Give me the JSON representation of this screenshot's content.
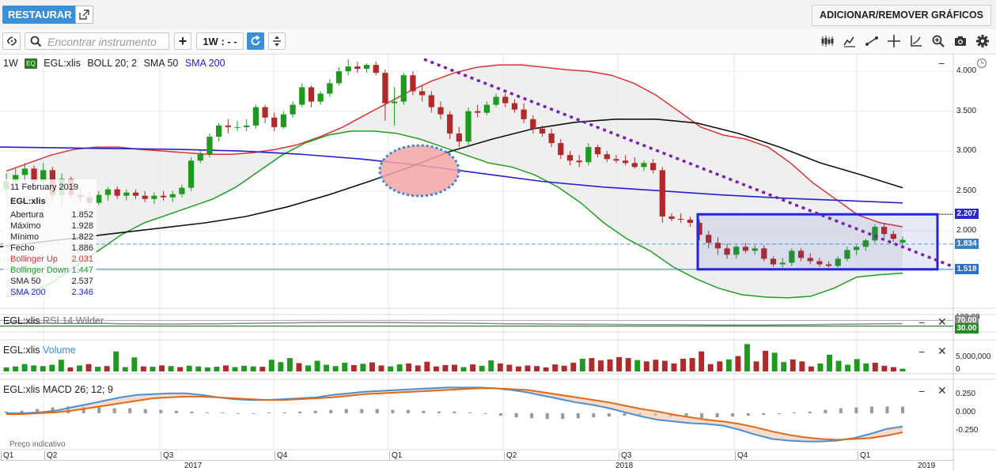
{
  "top_bar": {
    "restore_label": "RESTAURAR",
    "add_remove_label": "ADICIONAR/REMOVER GRÁFICOS"
  },
  "toolbar": {
    "search_placeholder": "Encontrar instrumento",
    "add_label": "+",
    "timeframe_label": "1W : - -"
  },
  "main_chart": {
    "timeframe": "1W",
    "eq_badge": "EQ",
    "symbol": "EGL:xlis",
    "boll": "BOLL 20; 2",
    "sma50": "SMA 50",
    "sma200": "SMA 200",
    "y_ticks": [
      "4.000",
      "3.500",
      "3.000",
      "2.500",
      "2.000",
      "1.500"
    ],
    "price_tags": [
      {
        "value": "2.207",
        "color": "#2a2ad0"
      },
      {
        "value": "1.834",
        "color": "#3a80c8"
      },
      {
        "value": "1.518",
        "color": "#2a6ed0"
      }
    ]
  },
  "info_box": {
    "date": "11 February 2019",
    "symbol": "EGL:xlis",
    "rows": [
      {
        "label": "Abertura",
        "value": "1.852",
        "color": "#222222"
      },
      {
        "label": "Máximo",
        "value": "1.928",
        "color": "#222222"
      },
      {
        "label": "Mínimo",
        "value": "1.822",
        "color": "#222222"
      },
      {
        "label": "Fecho",
        "value": "1.886",
        "color": "#222222"
      },
      {
        "label": "Bollinger Up",
        "value": "2.031",
        "color": "#d33333"
      },
      {
        "label": "Bollinger Down",
        "value": "1.447",
        "color": "#1e9a1e"
      },
      {
        "label": "SMA 50",
        "value": "2.537",
        "color": "#222222"
      },
      {
        "label": "SMA 200",
        "value": "2.346",
        "color": "#2222cc"
      }
    ]
  },
  "rsi_panel": {
    "symbol": "EGL:xlis",
    "label": "RSI 14 Wilder",
    "tick_top": "100.00",
    "tick_70": "70.00",
    "tick_30": "30.00"
  },
  "volume_panel": {
    "symbol": "EGL:xlis",
    "label": "Volume",
    "tick_top": "5,000,000",
    "tick_zero": "0"
  },
  "macd_panel": {
    "symbol": "EGL:xlis",
    "label": "MACD 26; 12; 9",
    "ticks": [
      "0.250",
      "0.000",
      "-0.250"
    ]
  },
  "footer": {
    "note": "Preço indicativo",
    "quarters": [
      "Q1",
      "Q2",
      "Q3",
      "Q4",
      "Q1",
      "Q2",
      "Q3",
      "Q4",
      "Q1"
    ],
    "years": [
      "2017",
      "2018",
      "2019"
    ]
  },
  "colors": {
    "accent": "#3a8fd8",
    "bull": "#1e9a1e",
    "bear": "#b02a2a",
    "boll_up": "#dd3333",
    "boll_down": "#1ea01e",
    "sma50": "#111111",
    "sma200": "#2222cc",
    "trend": "#7b1fb0",
    "rect": "#2424d8"
  },
  "chart_data": [
    {
      "type": "candlestick",
      "title": "EGL:xlis",
      "ylim": [
        1.05,
        4.2
      ],
      "y_ticks": [
        1.5,
        2.0,
        2.5,
        3.0,
        3.5,
        4.0
      ],
      "candles": [
        [
          2.52,
          2.72,
          2.42,
          2.62
        ],
        [
          2.62,
          2.78,
          2.55,
          2.7
        ],
        [
          2.7,
          2.85,
          2.62,
          2.78
        ],
        [
          2.78,
          2.82,
          2.55,
          2.62
        ],
        [
          2.62,
          2.85,
          2.58,
          2.76
        ],
        [
          2.76,
          2.8,
          2.38,
          2.45
        ],
        [
          2.45,
          2.72,
          2.3,
          2.65
        ],
        [
          2.65,
          2.68,
          2.4,
          2.45
        ],
        [
          2.45,
          2.52,
          2.35,
          2.42
        ],
        [
          2.42,
          2.5,
          2.3,
          2.35
        ],
        [
          2.35,
          2.5,
          2.32,
          2.45
        ],
        [
          2.45,
          2.55,
          2.38,
          2.52
        ],
        [
          2.52,
          2.56,
          2.4,
          2.44
        ],
        [
          2.44,
          2.52,
          2.38,
          2.48
        ],
        [
          2.48,
          2.52,
          2.4,
          2.44
        ],
        [
          2.44,
          2.5,
          2.36,
          2.4
        ],
        [
          2.4,
          2.48,
          2.34,
          2.44
        ],
        [
          2.44,
          2.5,
          2.38,
          2.42
        ],
        [
          2.42,
          2.5,
          2.36,
          2.46
        ],
        [
          2.46,
          2.58,
          2.42,
          2.54
        ],
        [
          2.54,
          2.92,
          2.5,
          2.88
        ],
        [
          2.88,
          3.0,
          2.85,
          2.96
        ],
        [
          2.96,
          3.22,
          2.92,
          3.18
        ],
        [
          3.18,
          3.35,
          3.12,
          3.32
        ],
        [
          3.32,
          3.4,
          3.22,
          3.3
        ],
        [
          3.3,
          3.38,
          3.25,
          3.3
        ],
        [
          3.3,
          3.4,
          3.25,
          3.32
        ],
        [
          3.32,
          3.58,
          3.28,
          3.55
        ],
        [
          3.55,
          3.58,
          3.35,
          3.42
        ],
        [
          3.42,
          3.48,
          3.25,
          3.3
        ],
        [
          3.3,
          3.5,
          3.28,
          3.46
        ],
        [
          3.46,
          3.62,
          3.42,
          3.58
        ],
        [
          3.58,
          3.85,
          3.55,
          3.8
        ],
        [
          3.8,
          3.82,
          3.55,
          3.62
        ],
        [
          3.62,
          3.75,
          3.58,
          3.72
        ],
        [
          3.72,
          3.9,
          3.68,
          3.85
        ],
        [
          3.85,
          4.05,
          3.82,
          4.0
        ],
        [
          4.0,
          4.15,
          3.95,
          4.06
        ],
        [
          4.06,
          4.12,
          3.98,
          4.03
        ],
        [
          4.03,
          4.1,
          3.98,
          4.08
        ],
        [
          4.08,
          4.12,
          3.95,
          3.98
        ],
        [
          3.98,
          4.02,
          3.38,
          3.6
        ],
        [
          3.6,
          3.8,
          3.32,
          3.62
        ],
        [
          3.62,
          3.98,
          3.58,
          3.95
        ],
        [
          3.95,
          4.0,
          3.7,
          3.75
        ],
        [
          3.75,
          3.82,
          3.62,
          3.7
        ],
        [
          3.7,
          3.75,
          3.48,
          3.55
        ],
        [
          3.55,
          3.62,
          3.4,
          3.46
        ],
        [
          3.46,
          3.5,
          3.15,
          3.22
        ],
        [
          3.22,
          3.3,
          3.05,
          3.12
        ],
        [
          3.12,
          3.55,
          3.05,
          3.5
        ],
        [
          3.5,
          3.58,
          3.42,
          3.48
        ],
        [
          3.48,
          3.62,
          3.45,
          3.58
        ],
        [
          3.58,
          3.72,
          3.55,
          3.68
        ],
        [
          3.68,
          3.72,
          3.55,
          3.6
        ],
        [
          3.6,
          3.65,
          3.48,
          3.52
        ],
        [
          3.52,
          3.6,
          3.35,
          3.4
        ],
        [
          3.4,
          3.45,
          3.22,
          3.28
        ],
        [
          3.28,
          3.32,
          3.18,
          3.22
        ],
        [
          3.22,
          3.28,
          3.05,
          3.1
        ],
        [
          3.1,
          3.15,
          2.9,
          2.95
        ],
        [
          2.95,
          3.0,
          2.82,
          2.88
        ],
        [
          2.88,
          2.95,
          2.8,
          2.86
        ],
        [
          2.86,
          3.1,
          2.82,
          3.05
        ],
        [
          3.05,
          3.08,
          2.92,
          2.96
        ],
        [
          2.96,
          3.0,
          2.86,
          2.9
        ],
        [
          2.9,
          2.95,
          2.85,
          2.88
        ],
        [
          2.88,
          2.95,
          2.82,
          2.85
        ],
        [
          2.85,
          2.92,
          2.78,
          2.8
        ],
        [
          2.8,
          2.88,
          2.75,
          2.85
        ],
        [
          2.85,
          2.9,
          2.72,
          2.76
        ],
        [
          2.76,
          2.8,
          2.1,
          2.18
        ],
        [
          2.18,
          2.22,
          2.12,
          2.15
        ],
        [
          2.15,
          2.22,
          2.1,
          2.14
        ],
        [
          2.14,
          2.18,
          2.05,
          2.1
        ],
        [
          2.1,
          2.14,
          1.88,
          1.95
        ],
        [
          1.95,
          2.0,
          1.78,
          1.85
        ],
        [
          1.85,
          1.92,
          1.7,
          1.78
        ],
        [
          1.78,
          1.84,
          1.65,
          1.7
        ],
        [
          1.7,
          1.82,
          1.65,
          1.8
        ],
        [
          1.8,
          1.85,
          1.72,
          1.75
        ],
        [
          1.75,
          1.82,
          1.7,
          1.78
        ],
        [
          1.78,
          1.82,
          1.62,
          1.65
        ],
        [
          1.65,
          1.68,
          1.55,
          1.58
        ],
        [
          1.58,
          1.66,
          1.54,
          1.6
        ],
        [
          1.6,
          1.78,
          1.56,
          1.75
        ],
        [
          1.75,
          1.78,
          1.62,
          1.66
        ],
        [
          1.66,
          1.72,
          1.58,
          1.62
        ],
        [
          1.62,
          1.66,
          1.55,
          1.58
        ],
        [
          1.58,
          1.62,
          1.54,
          1.56
        ],
        [
          1.56,
          1.68,
          1.54,
          1.65
        ],
        [
          1.65,
          1.8,
          1.62,
          1.76
        ],
        [
          1.76,
          1.82,
          1.7,
          1.8
        ],
        [
          1.8,
          1.9,
          1.75,
          1.88
        ],
        [
          1.88,
          2.08,
          1.85,
          2.05
        ],
        [
          2.05,
          2.1,
          1.92,
          1.96
        ],
        [
          1.96,
          2.0,
          1.86,
          1.9
        ],
        [
          1.852,
          1.928,
          1.822,
          1.886
        ]
      ],
      "bollinger_up": [
        2.75,
        2.85,
        2.95,
        3.02,
        3.05,
        3.05,
        3.02,
        3.0,
        2.98,
        2.96,
        2.96,
        2.98,
        3.02,
        3.08,
        3.18,
        3.3,
        3.45,
        3.6,
        3.75,
        3.88,
        3.98,
        4.05,
        4.08,
        4.08,
        4.05,
        4.02,
        4.0,
        3.95,
        3.85,
        3.7,
        3.5,
        3.3,
        3.2,
        3.15,
        3.05,
        2.85,
        2.6,
        2.4,
        2.2,
        2.1,
        2.05
      ],
      "bollinger_down": [
        1.18,
        1.22,
        1.35,
        1.55,
        1.75,
        1.95,
        2.1,
        2.2,
        2.3,
        2.4,
        2.55,
        2.75,
        2.95,
        3.1,
        3.2,
        3.25,
        3.25,
        3.22,
        3.15,
        3.05,
        2.95,
        2.85,
        2.8,
        2.7,
        2.55,
        2.35,
        2.1,
        1.9,
        1.75,
        1.55,
        1.4,
        1.28,
        1.2,
        1.17,
        1.16,
        1.18,
        1.28,
        1.42,
        1.45,
        1.47
      ],
      "sma50": [
        1.8,
        1.86,
        1.92,
        1.98,
        2.04,
        2.1,
        2.18,
        2.3,
        2.45,
        2.62,
        2.8,
        3.0,
        3.15,
        3.28,
        3.36,
        3.4,
        3.4,
        3.35,
        3.22,
        3.05,
        2.85,
        2.7,
        2.54
      ],
      "sma200": [
        3.05,
        3.04,
        3.03,
        3.02,
        3.0,
        2.96,
        2.9,
        2.82,
        2.72,
        2.62,
        2.55,
        2.5,
        2.45,
        2.41,
        2.38,
        2.35
      ],
      "trendline": [
        [
          4.15,
          0
        ],
        [
          1.55,
          1
        ]
      ],
      "zone": {
        "high": 2.207,
        "low": 1.518
      },
      "price_lines": [
        1.834,
        1.518
      ]
    },
    {
      "type": "line",
      "title": "RSI 14 Wilder",
      "ylim": [
        0,
        100
      ],
      "values": [
        55,
        52,
        50,
        48,
        50,
        46,
        45,
        44,
        45,
        46,
        48,
        50,
        52,
        54,
        55,
        56,
        55,
        54,
        53,
        52,
        50,
        48,
        46,
        45,
        44,
        43,
        42,
        41,
        40,
        40,
        39,
        38,
        38,
        38,
        39,
        40,
        42,
        44,
        46,
        47
      ]
    },
    {
      "type": "bar",
      "title": "Volume",
      "ylim": [
        0,
        9000000
      ],
      "values": [
        1200000,
        1500000,
        2200000,
        1800000,
        1600000,
        2000000,
        3500000,
        1200000,
        1800000,
        2200000,
        1400000,
        1600000,
        6000000,
        1300000,
        4200000,
        1500000,
        1400000,
        1800000,
        1600000,
        1300000,
        1700000,
        1500000,
        1200000,
        1400000,
        1800000,
        1300000,
        1700000,
        1500000,
        1400000,
        3500000,
        2800000,
        4000000,
        2500000,
        1800000,
        3200000,
        2000000,
        1600000,
        2600000,
        1900000,
        2300000,
        2700000,
        1800000,
        1500000,
        2100000,
        2400000,
        1800000,
        2900000,
        1500000,
        1900000,
        2000000,
        1300000,
        2100000,
        1700000,
        3300000,
        2400000,
        2000000,
        1500000,
        1800000,
        1600000,
        1200000,
        2100000,
        1700000,
        2600000,
        3800000,
        4000000,
        3300000,
        3600000,
        4300000,
        4000000,
        3400000,
        3000000,
        3500000,
        3200000,
        2400000,
        3800000,
        4000000,
        6000000,
        2200000,
        3000000,
        3600000,
        4600000,
        8200000,
        3000000,
        6200000,
        5600000,
        2800000,
        3600000,
        3000000,
        1500000,
        2400000,
        5000000,
        3200000,
        2000000,
        3700000,
        2400000,
        2600000,
        1700000,
        1300000,
        800000
      ],
      "up": [
        1,
        1,
        1,
        1,
        1,
        1,
        1,
        0,
        1,
        0,
        1,
        0,
        1,
        1,
        1,
        0,
        1,
        0,
        1,
        0,
        1,
        1,
        1,
        1,
        0,
        1,
        1,
        1,
        0,
        1,
        1,
        1,
        0,
        1,
        1,
        1,
        1,
        1,
        0,
        1,
        0,
        0,
        1,
        1,
        0,
        0,
        0,
        0,
        0,
        0,
        1,
        0,
        1,
        1,
        0,
        0,
        0,
        0,
        0,
        0,
        0,
        0,
        0,
        1,
        0,
        0,
        0,
        0,
        0,
        1,
        0,
        0,
        0,
        0,
        0,
        0,
        0,
        0,
        0,
        1,
        0,
        1,
        0,
        0,
        1,
        1,
        0,
        0,
        0,
        1,
        1,
        1,
        1,
        1,
        1,
        0,
        0,
        0,
        1
      ]
    },
    {
      "type": "line",
      "title": "MACD 26; 12; 9",
      "ylim": [
        -0.42,
        0.38
      ],
      "macd": [
        0.0,
        0.0,
        0.01,
        0.03,
        0.07,
        0.11,
        0.15,
        0.19,
        0.22,
        0.23,
        0.24,
        0.24,
        0.22,
        0.19,
        0.17,
        0.16,
        0.16,
        0.17,
        0.18,
        0.19,
        0.22,
        0.24,
        0.26,
        0.27,
        0.28,
        0.29,
        0.3,
        0.31,
        0.31,
        0.31,
        0.3,
        0.28,
        0.25,
        0.21,
        0.17,
        0.13,
        0.1,
        0.06,
        0.01,
        -0.04,
        -0.08,
        -0.1,
        -0.12,
        -0.13,
        -0.15,
        -0.2,
        -0.26,
        -0.31,
        -0.33,
        -0.34,
        -0.34,
        -0.33,
        -0.3,
        -0.25,
        -0.19,
        -0.16
      ],
      "signal": [
        -0.01,
        -0.01,
        0.0,
        0.01,
        0.03,
        0.06,
        0.09,
        0.12,
        0.15,
        0.18,
        0.19,
        0.2,
        0.2,
        0.19,
        0.18,
        0.17,
        0.16,
        0.16,
        0.17,
        0.18,
        0.19,
        0.21,
        0.23,
        0.24,
        0.25,
        0.26,
        0.27,
        0.28,
        0.29,
        0.3,
        0.3,
        0.29,
        0.28,
        0.25,
        0.22,
        0.19,
        0.16,
        0.13,
        0.09,
        0.05,
        0.02,
        -0.02,
        -0.05,
        -0.08,
        -0.1,
        -0.13,
        -0.17,
        -0.22,
        -0.26,
        -0.29,
        -0.31,
        -0.32,
        -0.31,
        -0.3,
        -0.27,
        -0.23
      ],
      "hist": [
        0.02,
        0.03,
        0.05,
        0.07,
        0.08,
        0.08,
        0.07,
        0.06,
        0.06,
        0.05,
        0.04,
        0.03,
        0.02,
        0.01,
        0.01,
        0.0,
        0.0,
        0.01,
        0.01,
        0.02,
        0.03,
        0.04,
        0.05,
        0.05,
        0.05,
        0.04,
        0.04,
        0.03,
        0.02,
        0.02,
        0.01,
        -0.01,
        -0.03,
        -0.05,
        -0.06,
        -0.07,
        -0.07,
        -0.06,
        -0.05,
        -0.04,
        -0.03,
        -0.02,
        -0.03,
        -0.04,
        -0.05,
        -0.06,
        -0.05,
        -0.04,
        -0.03,
        -0.02,
        -0.01,
        0.01,
        0.02,
        0.04,
        0.06,
        0.07,
        0.08,
        0.08,
        0.08
      ]
    }
  ]
}
